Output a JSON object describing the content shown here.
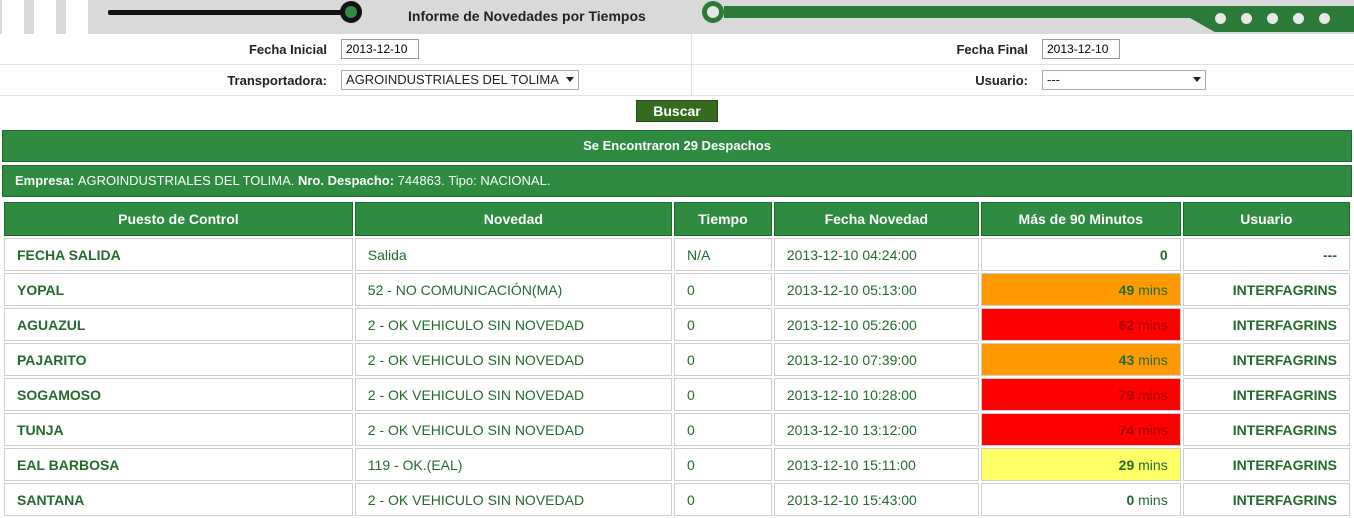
{
  "header": {
    "title": "Informe de Novedades por Tiempos"
  },
  "filters": {
    "fecha_inicial_label": "Fecha Inicial",
    "fecha_inicial_value": "2013-12-10",
    "fecha_final_label": "Fecha Final",
    "fecha_final_value": "2013-12-10",
    "transportadora_label": "Transportadora:",
    "transportadora_value": "AGROINDUSTRIALES DEL TOLIMA",
    "usuario_label": "Usuario:",
    "usuario_value": "---",
    "buscar_label": "Buscar"
  },
  "summary": "Se Encontraron 29 Despachos",
  "dispatch": {
    "empresa_label": "Empresa:",
    "empresa_value": "AGROINDUSTRIALES DEL TOLIMA.",
    "nro_label": "Nro. Despacho:",
    "nro_value": "744863.",
    "tipo_text": "Tipo: NACIONAL."
  },
  "table": {
    "columns": [
      "Puesto de Control",
      "Novedad",
      "Tiempo",
      "Fecha Novedad",
      "Más de 90 Minutos",
      "Usuario"
    ],
    "rows": [
      {
        "puesto": "FECHA SALIDA",
        "novedad": "Salida",
        "tiempo": "N/A",
        "fecha": "2013-12-10 04:24:00",
        "mas_num": "0",
        "mas_unit": "",
        "usuario": "---",
        "color": "#ffffff"
      },
      {
        "puesto": "YOPAL",
        "novedad": "52 - NO COMUNICACIÓN(MA)",
        "tiempo": "0",
        "fecha": "2013-12-10 05:13:00",
        "mas_num": "49",
        "mas_unit": " mins",
        "usuario": "INTERFAGRINS",
        "color": "#ff9900"
      },
      {
        "puesto": "AGUAZUL",
        "novedad": "2 - OK VEHICULO SIN NOVEDAD",
        "tiempo": "0",
        "fecha": "2013-12-10 05:26:00",
        "mas_num": "62",
        "mas_unit": " mins",
        "usuario": "INTERFAGRINS",
        "color": "#ff0000"
      },
      {
        "puesto": "PAJARITO",
        "novedad": "2 - OK VEHICULO SIN NOVEDAD",
        "tiempo": "0",
        "fecha": "2013-12-10 07:39:00",
        "mas_num": "43",
        "mas_unit": " mins",
        "usuario": "INTERFAGRINS",
        "color": "#ff9900"
      },
      {
        "puesto": "SOGAMOSO",
        "novedad": "2 - OK VEHICULO SIN NOVEDAD",
        "tiempo": "0",
        "fecha": "2013-12-10 10:28:00",
        "mas_num": "79",
        "mas_unit": " mins",
        "usuario": "INTERFAGRINS",
        "color": "#ff0000"
      },
      {
        "puesto": "TUNJA",
        "novedad": "2 - OK VEHICULO SIN NOVEDAD",
        "tiempo": "0",
        "fecha": "2013-12-10 13:12:00",
        "mas_num": "74",
        "mas_unit": " mins",
        "usuario": "INTERFAGRINS",
        "color": "#ff0000"
      },
      {
        "puesto": "EAL BARBOSA",
        "novedad": "119 - OK.(EAL)",
        "tiempo": "0",
        "fecha": "2013-12-10 15:11:00",
        "mas_num": "29",
        "mas_unit": " mins",
        "usuario": "INTERFAGRINS",
        "color": "#ffff66"
      },
      {
        "puesto": "SANTANA",
        "novedad": "2 - OK VEHICULO SIN NOVEDAD",
        "tiempo": "0",
        "fecha": "2013-12-10 15:43:00",
        "mas_num": "0",
        "mas_unit": " mins",
        "usuario": "INTERFAGRINS",
        "color": "#ffffff"
      }
    ]
  }
}
